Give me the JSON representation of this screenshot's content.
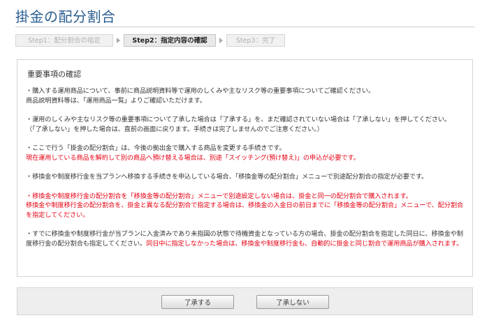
{
  "page": {
    "title": "掛金の配分割合"
  },
  "steps": [
    {
      "label": "Step1：配分割合の指定",
      "state": "done"
    },
    {
      "label": "Step2：指定内容の確認",
      "state": "current"
    },
    {
      "label": "Step3：完了",
      "state": "upcoming"
    }
  ],
  "panel": {
    "heading": "重要事項の確認",
    "p1": {
      "l1": "・購入する運用商品について、事前に商品説明資料等で運用のしくみや主なリスク等の重要事項についてご確認ください。",
      "l2": "商品説明資料等は、「運用商品一覧」よりご確認いただけます。"
    },
    "p2": {
      "l1": "・運用のしくみや主なリスク等の重要事項について了承した場合は「了承する」を、まだ確認されていない場合は「了承しない」を押してください。",
      "l2": "（「了承しない」を押した場合は、直前の画面に戻ります。手続きは完了しませんのでご注意ください。）"
    },
    "p3": {
      "l1": "・ここで行う「掛金の配分割合」は、今後の拠出金で購入する商品を変更する手続きです。",
      "l2": "現在運用している商品を解約して別の商品へ預け替える場合は、別途「スイッチング(預け替え)」の申込が必要です。"
    },
    "p4": {
      "l1": "・移換金や制度移行金を当プランへ移換する手続きを申込している場合、「移換金等の配分割合」メニューで別途配分割合の指定が必要です。"
    },
    "p5": {
      "l1": "・移換金や制度移行金の配分割合を「移換金等の配分割合」メニューで別途設定しない場合は、掛金と同一の配分割合で購入されます。",
      "l2": "移換金や制度移行金の配分割合を、掛金と異なる配分割合で指定する場合は、移換金の入金日の前日までに「移換金等の配分割合」メニューで、配分割合を指定してください。"
    },
    "p6": {
      "black": "・すでに移換金や制度移行金が当プランに入金済みであり未指図の状態で待機資金となっている方の場合、掛金の配分割合を指定した同日に、移換金や制度移行金の配分割合も指定してください。",
      "red": "同日中に指定しなかった場合は、移換金や制度移行金も、自動的に掛金と同じ割合で運用商品が購入されます。"
    }
  },
  "buttons": {
    "accept": "了承する",
    "decline": "了承しない"
  },
  "colors": {
    "title": "#2a5d8f",
    "warning": "#e60012"
  }
}
